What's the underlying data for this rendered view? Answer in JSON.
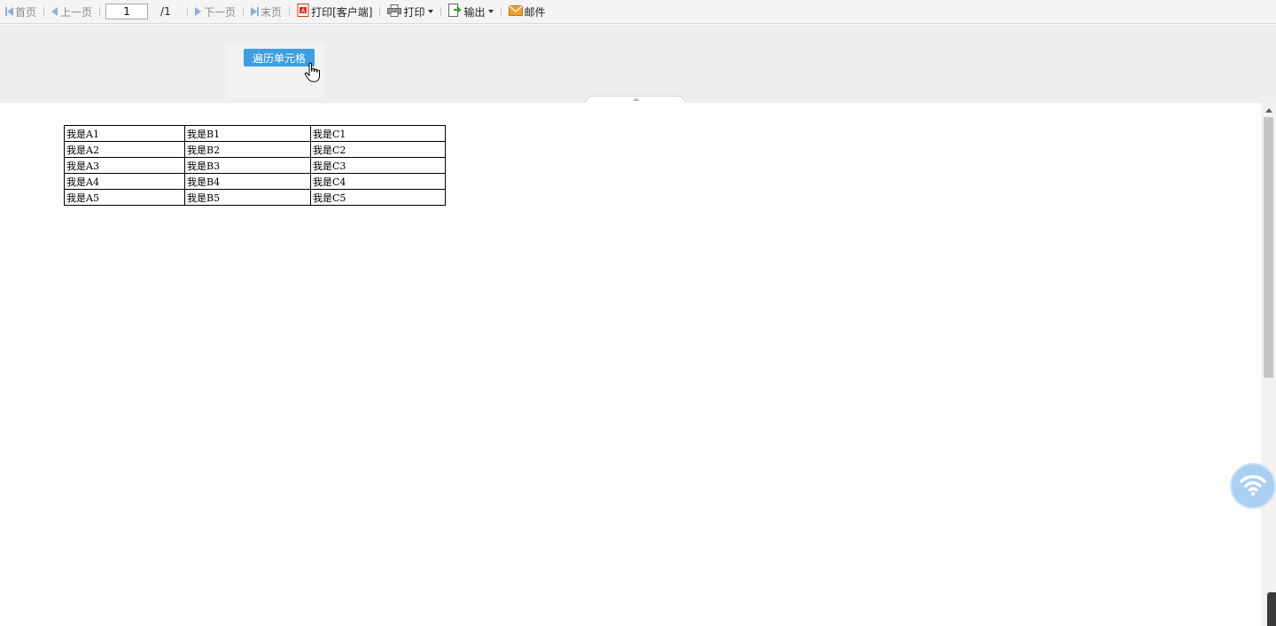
{
  "toolbar": {
    "first": "首页",
    "prev": "上一页",
    "page_value": "1",
    "page_total": "/1",
    "next": "下一页",
    "last": "末页",
    "print_client": "打印[客户端]",
    "print": "打印",
    "export": "输出",
    "mail": "邮件"
  },
  "params": {
    "button_label": "遍历单元格"
  },
  "report": {
    "rows": [
      [
        "我是A1",
        "我是B1",
        "我是C1"
      ],
      [
        "我是A2",
        "我是B2",
        "我是C2"
      ],
      [
        "我是A3",
        "我是B3",
        "我是C3"
      ],
      [
        "我是A4",
        "我是B4",
        "我是C4"
      ],
      [
        "我是A5",
        "我是B5",
        "我是C5"
      ]
    ]
  },
  "colors": {
    "accent": "#3d9ee0",
    "nav_arrow": "#8fb0cf",
    "pdf_red": "#d0321e",
    "mail_orange": "#f0a030",
    "export_green": "#3a9a3a"
  },
  "icons": [
    "first-page-icon",
    "prev-page-icon",
    "next-page-icon",
    "last-page-icon",
    "pdf-icon",
    "printer-icon",
    "export-icon",
    "mail-icon",
    "hand-cursor-icon",
    "wifi-icon"
  ]
}
